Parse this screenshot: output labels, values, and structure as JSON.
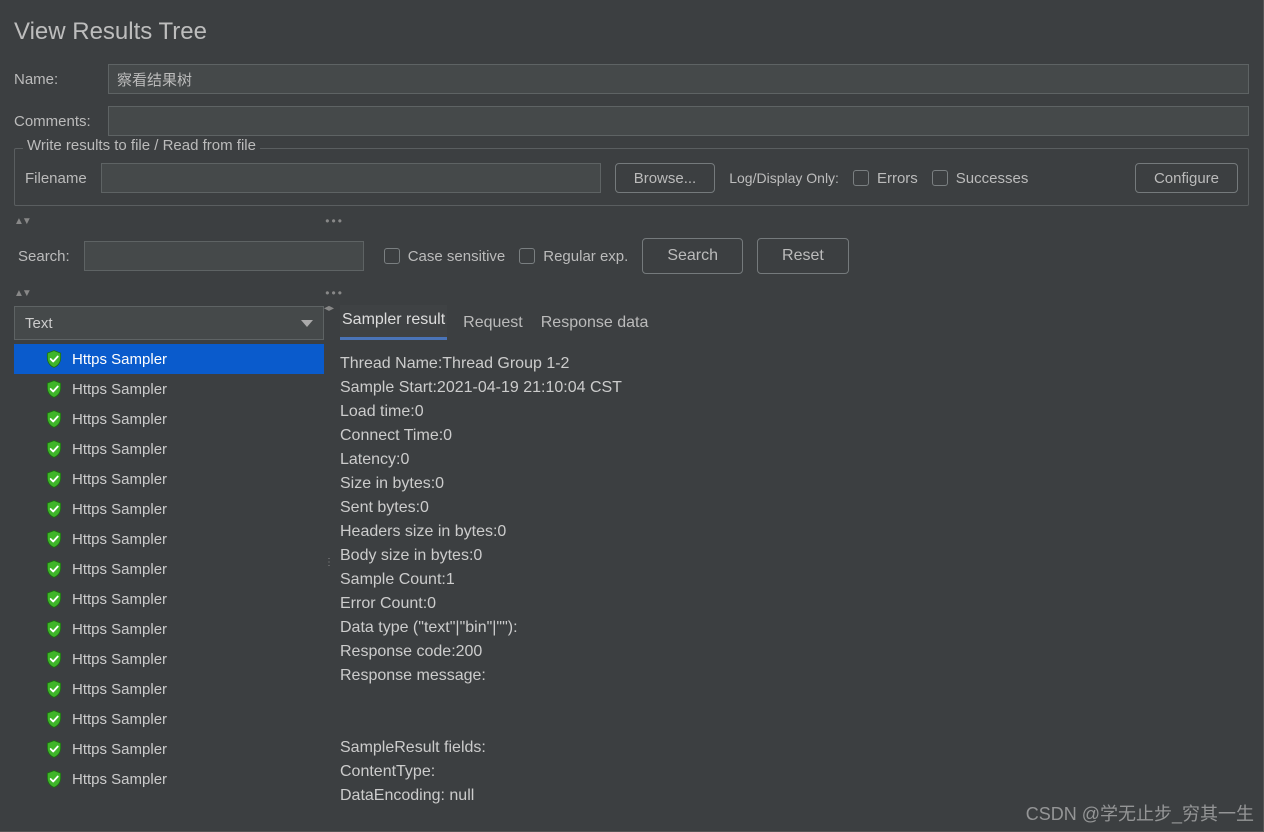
{
  "page_title": "View Results Tree",
  "fields": {
    "name_label": "Name:",
    "name_value": "察看结果树",
    "comments_label": "Comments:",
    "comments_value": ""
  },
  "file_group": {
    "legend": "Write results to file / Read from file",
    "filename_label": "Filename",
    "filename_value": "",
    "browse_btn": "Browse...",
    "logdisplay_label": "Log/Display Only:",
    "errors_label": "Errors",
    "successes_label": "Successes",
    "configure_btn": "Configure"
  },
  "search": {
    "label": "Search:",
    "value": "",
    "case_label": "Case sensitive",
    "regex_label": "Regular exp.",
    "search_btn": "Search",
    "reset_btn": "Reset"
  },
  "dropdown_value": "Text",
  "tree_items": [
    {
      "label": "Https Sampler",
      "selected": true
    },
    {
      "label": "Https Sampler",
      "selected": false
    },
    {
      "label": "Https Sampler",
      "selected": false
    },
    {
      "label": "Https Sampler",
      "selected": false
    },
    {
      "label": "Https Sampler",
      "selected": false
    },
    {
      "label": "Https Sampler",
      "selected": false
    },
    {
      "label": "Https Sampler",
      "selected": false
    },
    {
      "label": "Https Sampler",
      "selected": false
    },
    {
      "label": "Https Sampler",
      "selected": false
    },
    {
      "label": "Https Sampler",
      "selected": false
    },
    {
      "label": "Https Sampler",
      "selected": false
    },
    {
      "label": "Https Sampler",
      "selected": false
    },
    {
      "label": "Https Sampler",
      "selected": false
    },
    {
      "label": "Https Sampler",
      "selected": false
    },
    {
      "label": "Https Sampler",
      "selected": false
    }
  ],
  "tabs": [
    {
      "label": "Sampler result",
      "active": true
    },
    {
      "label": "Request",
      "active": false
    },
    {
      "label": "Response data",
      "active": false
    }
  ],
  "sampler_result_lines": [
    "Thread Name:Thread Group 1-2",
    "Sample Start:2021-04-19 21:10:04 CST",
    "Load time:0",
    "Connect Time:0",
    "Latency:0",
    "Size in bytes:0",
    "Sent bytes:0",
    "Headers size in bytes:0",
    "Body size in bytes:0",
    "Sample Count:1",
    "Error Count:0",
    "Data type (\"text\"|\"bin\"|\"\"):",
    "Response code:200",
    "Response message:",
    "",
    "",
    "SampleResult fields:",
    "ContentType:",
    "DataEncoding: null"
  ],
  "watermark": "CSDN @学无止步_穷其一生"
}
